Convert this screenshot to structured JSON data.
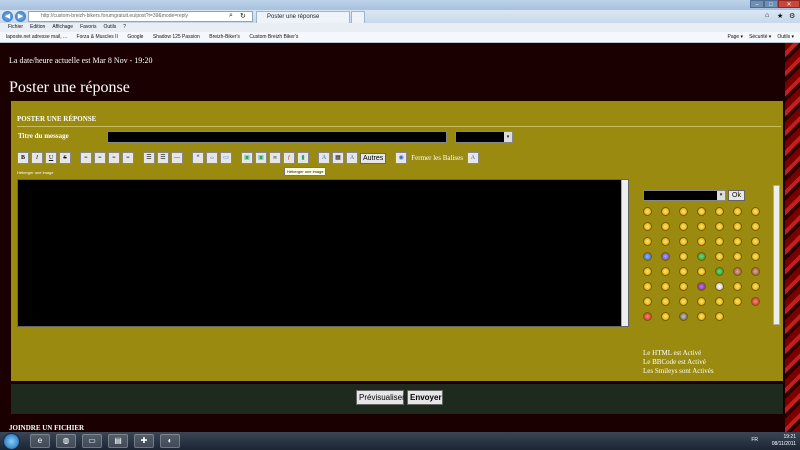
{
  "browser": {
    "address": "http://custom-breizh-bikers.forumgratuit.eu/post?t=39&mode=reply",
    "tab_title": "Poster une réponse",
    "menu": [
      "Fichier",
      "Edition",
      "Affichage",
      "Favoris",
      "Outils",
      "?"
    ],
    "favorites": [
      "laposte.net  adresse mail, ...",
      "Forza & Muscles II",
      "Google",
      "Shadow 125 Passion",
      "Breizh-Biker's",
      "Custom Breizh Biker's"
    ],
    "tools": [
      "Page ▾",
      "Sécurité ▾",
      "Outils ▾"
    ],
    "icons": [
      "back-icon",
      "forward-icon",
      "search-icon",
      "refresh-icon",
      "close-icon",
      "home-icon",
      "star-icon",
      "gear-icon"
    ]
  },
  "page": {
    "current_date": "La date/heure actuelle est Mar 8 Nov - 19:20",
    "title": "Poster une réponse",
    "form_heading": "POSTER UNE RÉPONSE",
    "title_label": "Titre du message",
    "toolbar": {
      "buttons": [
        "B",
        "I",
        "U",
        "S"
      ],
      "autres_label": "Autres",
      "close_tags_label": "Fermer les Balises"
    },
    "tooltip": "Héberger une image",
    "hint": "Héberger une image",
    "ok_label": "Ok",
    "status": [
      "Le HTML est Activé",
      "Le BBCode est Activé",
      "Les Smileys sont Activés"
    ],
    "preview_label": "Prévisualiser",
    "send_label": "Envoyer",
    "attach_heading": "JOINDRE UN FICHIER"
  },
  "taskbar": {
    "lang": "FR",
    "time": "19:21",
    "date": "08/11/2011"
  },
  "colors": {
    "panel": "#9a8a10",
    "background": "#1a0000",
    "actions_bar": "#1f2a1f"
  }
}
